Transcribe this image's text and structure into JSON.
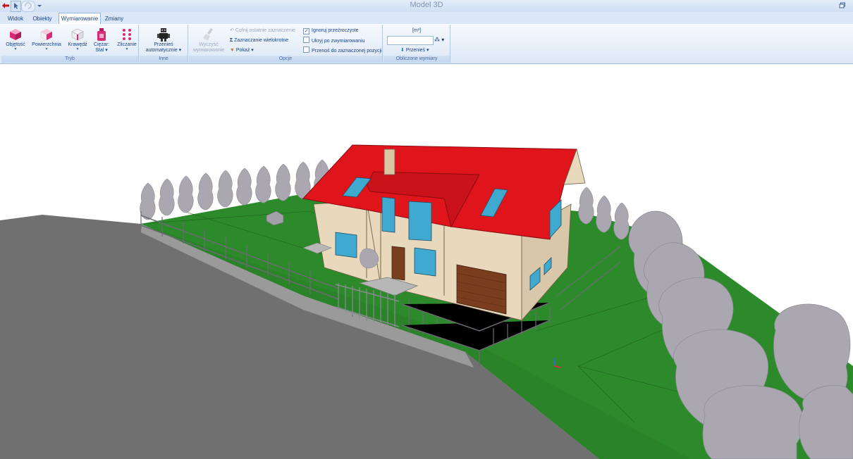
{
  "window": {
    "title": "Model 3D"
  },
  "tabs": [
    {
      "label": "Widok"
    },
    {
      "label": "Obiekty"
    },
    {
      "label": "Wymiarowanie"
    },
    {
      "label": "Zmiany"
    }
  ],
  "ribbon": {
    "tryb": {
      "label": "Tryb",
      "buttons": [
        {
          "label": "Objętość"
        },
        {
          "label": "Powierzchnia"
        },
        {
          "label": "Krawędź"
        },
        {
          "label_line1": "Ciężar:",
          "label_line2": "Stal"
        },
        {
          "label": "Zliczanie"
        }
      ]
    },
    "inne": {
      "label": "Inne",
      "przenies": {
        "line1": "Przenieś",
        "line2": "automatycznie"
      }
    },
    "opcje": {
      "label": "Opcje",
      "wyczysc": {
        "line1": "Wyczyść",
        "line2": "wymiarowanie"
      },
      "cofnij": "Cofnij ostatnie zaznaczenie",
      "zaznaczanie": "Zaznaczanie wielokrotne",
      "pokaz": "Pokaż",
      "ignoruj": {
        "label": "Ignoruj przeźroczyste",
        "checked": true
      },
      "ukryj": {
        "label": "Ukryj po zwymiarowaniu",
        "checked": false
      },
      "przenos": {
        "label": "Przenoś do zaznaczonej pozycji",
        "checked": false
      }
    },
    "obliczone": {
      "label": "Obliczone wymiary",
      "unit": "[m²]",
      "value": "",
      "przenies": "Przenieś"
    }
  },
  "scene": {
    "roof_color": "#e0151c",
    "wall_color": "#e8d8bc",
    "grass_color": "#2c8a2b",
    "tree_color": "#a9a6b0",
    "road_color": "#6f6f6f",
    "window_color": "#3fa9d0",
    "garage_color": "#7a3d1e"
  }
}
